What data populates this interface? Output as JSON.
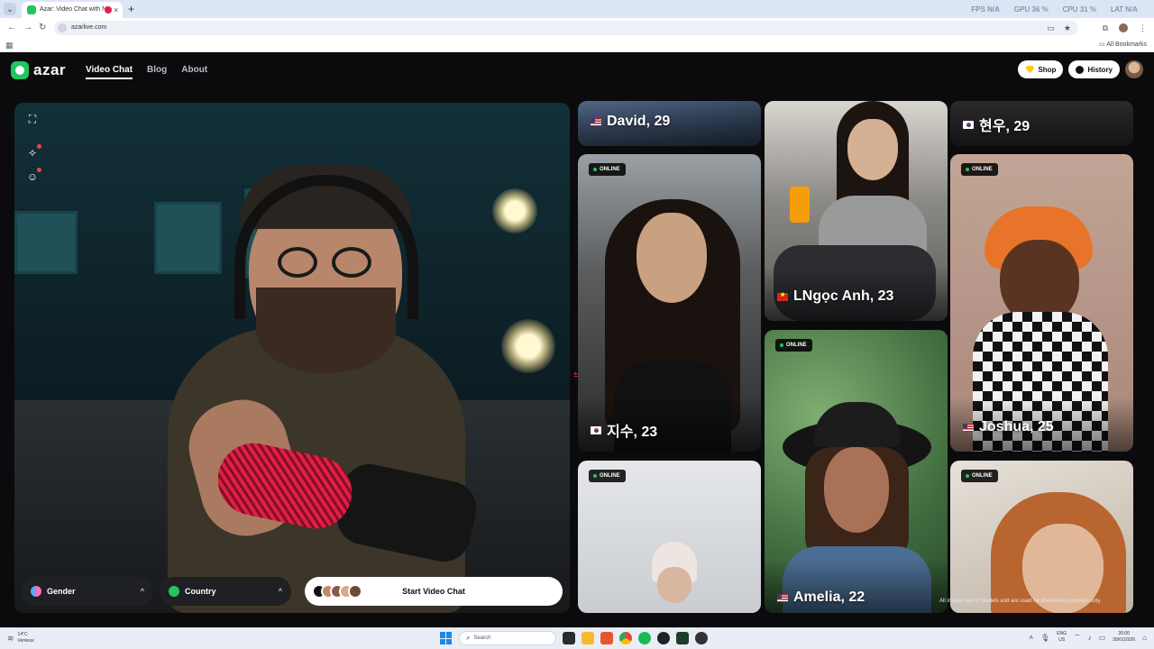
{
  "browser": {
    "tab_title": "Azar: Video Chat with New",
    "tab_close": "×",
    "new_tab": "+",
    "url": "azarlive.com",
    "all_bookmarks": "All Bookmarks",
    "perf": [
      {
        "label": "FPS",
        "value": "N/A"
      },
      {
        "label": "GPU",
        "value": "36 %"
      },
      {
        "label": "CPU",
        "value": "31 %"
      },
      {
        "label": "LAT",
        "value": "N/A"
      }
    ],
    "window_controls": [
      "–",
      "☐",
      "✕"
    ]
  },
  "site": {
    "logo": "azar",
    "nav": [
      {
        "label": "Video Chat",
        "active": true
      },
      {
        "label": "Blog",
        "active": false
      },
      {
        "label": "About",
        "active": false
      }
    ],
    "shop_label": "Shop",
    "history_label": "History"
  },
  "camera": {
    "tools": [
      "expand-icon",
      "magic-wand-icon",
      "emoji-icon"
    ],
    "gender_label": "Gender",
    "country_label": "Country",
    "chevron": "^",
    "start_label": "Start Video Chat"
  },
  "profiles": {
    "online_label": "ONLINE",
    "cards": [
      {
        "id": "david",
        "name": "David, 29",
        "flag": "us",
        "online": false
      },
      {
        "id": "jisu",
        "name": "지수, 23",
        "flag": "kr",
        "online": true
      },
      {
        "id": "ngoc-anh",
        "name": "LNgọc Anh, 23",
        "flag": "vn",
        "online": false
      },
      {
        "id": "amelia",
        "name": "Amelia, 22",
        "flag": "us",
        "online": true
      },
      {
        "id": "hyunwoo",
        "name": "현우, 29",
        "flag": "kr",
        "online": false
      },
      {
        "id": "joshua",
        "name": "Joshua, 25",
        "flag": "us",
        "online": true
      },
      {
        "id": "snow-girl",
        "name": "",
        "flag": "",
        "online": true
      },
      {
        "id": "redhead",
        "name": "",
        "flag": "",
        "online": true
      }
    ],
    "disclaimer": "All images are of models and are used for illustrative purposes only."
  },
  "taskbar": {
    "temperature": "14°C",
    "weather": "Venteux",
    "search_placeholder": "Search",
    "lang_top": "ENG",
    "lang_bottom": "US",
    "time": "20:00",
    "date": "30/01/2026"
  },
  "colors": {
    "brand": "#22c55e",
    "online_dot": "#22c55e",
    "recording": "#e11d48"
  }
}
